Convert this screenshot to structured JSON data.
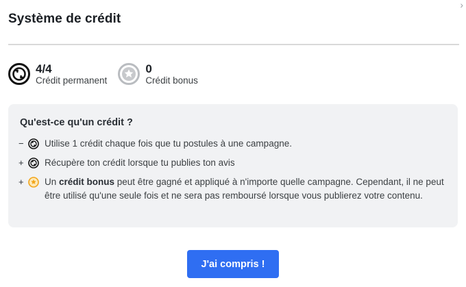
{
  "modal": {
    "title": "Système de crédit",
    "close_glyph": "›"
  },
  "credits": {
    "permanent": {
      "value": "4/4",
      "label": "Crédit permanent",
      "icon": "permanent-credit-icon"
    },
    "bonus": {
      "value": "0",
      "label": "Crédit bonus",
      "icon": "star-icon"
    }
  },
  "info": {
    "title": "Qu'est-ce qu'un crédit ?",
    "rules": [
      {
        "sign": "−",
        "icon": "permanent-credit-icon",
        "text": "Utilise 1 crédit chaque fois que tu postules à une campagne."
      },
      {
        "sign": "+",
        "icon": "permanent-credit-icon",
        "text": "Récupère ton crédit lorsque tu publies ton avis"
      },
      {
        "sign": "+",
        "icon": "star-icon",
        "text_before": "Un ",
        "bold": "crédit bonus",
        "text_after": " peut être gagné et appliqué à n'importe quelle campagne. Cependant, il ne peut être utilisé qu'une seule fois et ne sera pas remboursé lorsque vous publierez votre contenu."
      }
    ]
  },
  "footer": {
    "confirm_label": "J'ai compris !"
  },
  "colors": {
    "accent": "#2f6ef2",
    "info_background": "#f1f2f4",
    "star": "#f2a51a"
  }
}
